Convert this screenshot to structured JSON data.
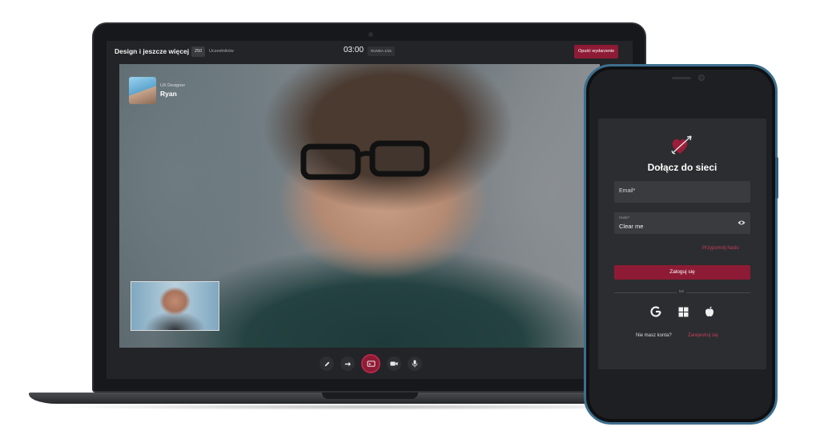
{
  "laptop": {
    "event_title": "Design i jeszcze więcej",
    "participants_count": "250",
    "participants_label": "Uczestników",
    "timer": "03:00",
    "round": "RUNDA 1/15",
    "leave_button": "Opuść wydarzenie",
    "speaker": {
      "role": "UX Designer",
      "name": "Ryan"
    },
    "controls": [
      "pencil-icon",
      "arrow-right-icon",
      "screen-share-icon",
      "camera-icon",
      "microphone-icon"
    ]
  },
  "phone": {
    "title": "Dołącz do sieci",
    "email_label": "Email*",
    "password_label": "Hasło*",
    "password_value": "Clear me",
    "forgot_link": "Przypomnij hasło",
    "login_button": "Zaloguj się",
    "divider_label": "lub",
    "social": [
      "google-icon",
      "windows-icon",
      "apple-icon"
    ],
    "signup_question": "Nie masz konta?",
    "signup_link": "Zarejestruj się"
  },
  "colors": {
    "accent": "#8e1b35",
    "accent_text": "#c43d5c",
    "background_dark": "#232427",
    "phone_frame": "#3d6f8f"
  }
}
